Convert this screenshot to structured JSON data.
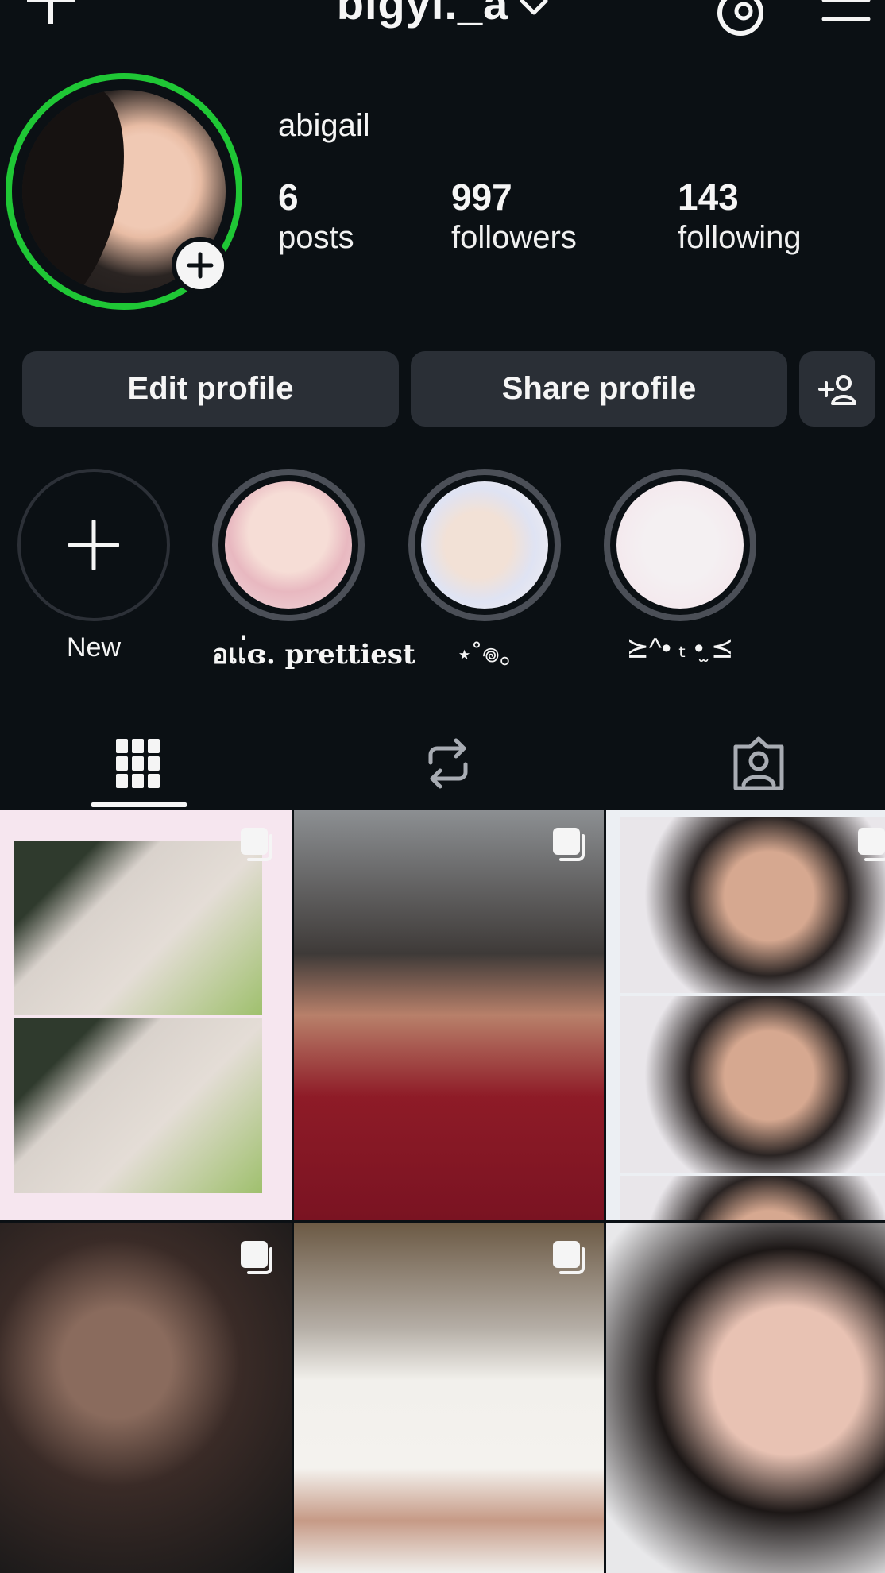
{
  "header": {
    "title": "bigyl._a",
    "icons": [
      "plus-icon",
      "chevron-down-icon",
      "threads-icon",
      "menu-icon"
    ]
  },
  "profile": {
    "display_name": "abigail",
    "stats": [
      {
        "value": "6",
        "label": "posts"
      },
      {
        "value": "997",
        "label": "followers"
      },
      {
        "value": "143",
        "label": "following"
      }
    ],
    "story_ring_color": "#1fc735"
  },
  "actions": {
    "edit_label": "Edit profile",
    "share_label": "Share profile"
  },
  "highlights": [
    {
      "label": "New"
    },
    {
      "label": "อเเ่ɞ. prettiest"
    },
    {
      "label": "⋆˚𖦹｡"
    },
    {
      "label": "⪰^• ₜ •̫ ⪯"
    }
  ],
  "tabs": [
    "grid-icon",
    "reels-icon",
    "tagged-icon"
  ],
  "colors": {
    "background": "#0b1014",
    "button_bg": "#2a2f36",
    "text": "#f5f5f5"
  }
}
